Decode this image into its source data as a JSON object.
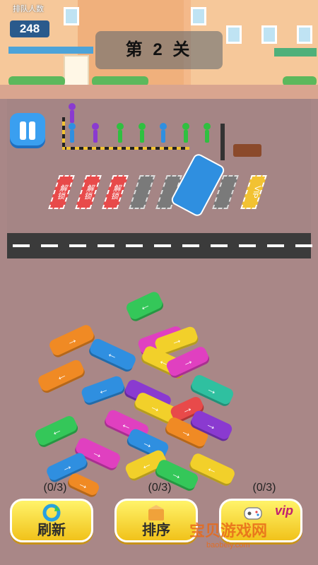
{
  "hud": {
    "queue_label": "排队人数",
    "queue_count": "248",
    "level_title": "第 2 关"
  },
  "parking": {
    "locked_label": "解锁",
    "vip_label": "VIP"
  },
  "actions": [
    {
      "count": "(0/3)",
      "label": "刷新",
      "icon": "refresh-icon"
    },
    {
      "count": "(0/3)",
      "label": "排序",
      "icon": "box-icon"
    },
    {
      "count": "(0/3)",
      "label": "",
      "badge": "vip",
      "icon": "gamepad-icon"
    }
  ],
  "watermark": {
    "text": "宝贝游戏网",
    "sub": "baobeiy.com"
  },
  "colors": {
    "background": "#a98787",
    "road": "#3b3b3b",
    "button": "#f1c21a",
    "pause": "#3a9ff0"
  },
  "people_colors": [
    "#8a3ad0",
    "#2f8fe0",
    "#8a3ad0",
    "#2fc040",
    "#2fc040",
    "#2f8fe0",
    "#2fc040",
    "#2fc040"
  ],
  "cars": [
    {
      "color": "#34c759",
      "dir": "←"
    },
    {
      "color": "#e040c0",
      "dir": "→"
    },
    {
      "color": "#f08a24",
      "dir": "→"
    },
    {
      "color": "#f2d02a",
      "dir": "→"
    },
    {
      "color": "#2f8fe0",
      "dir": "←"
    },
    {
      "color": "#f2d02a",
      "dir": "←"
    },
    {
      "color": "#e040c0",
      "dir": "→"
    },
    {
      "color": "#f08a24",
      "dir": "←"
    },
    {
      "color": "#2f8fe0",
      "dir": "←"
    },
    {
      "color": "#8a3ad0",
      "dir": "→"
    },
    {
      "color": "#2fc0a0",
      "dir": "→"
    },
    {
      "color": "#f2d02a",
      "dir": "→"
    },
    {
      "color": "#e040c0",
      "dir": "←"
    },
    {
      "color": "#e84a4a",
      "dir": "→"
    },
    {
      "color": "#34c759",
      "dir": "←"
    },
    {
      "color": "#f08a24",
      "dir": "→"
    },
    {
      "color": "#8a3ad0",
      "dir": "→"
    },
    {
      "color": "#2f8fe0",
      "dir": "→"
    },
    {
      "color": "#e040c0",
      "dir": "→"
    },
    {
      "color": "#f2d02a",
      "dir": "←"
    },
    {
      "color": "#34c759",
      "dir": "→"
    },
    {
      "color": "#2f8fe0",
      "dir": "→"
    },
    {
      "color": "#f08a24",
      "dir": "→"
    },
    {
      "color": "#f2d02a",
      "dir": "←"
    }
  ]
}
